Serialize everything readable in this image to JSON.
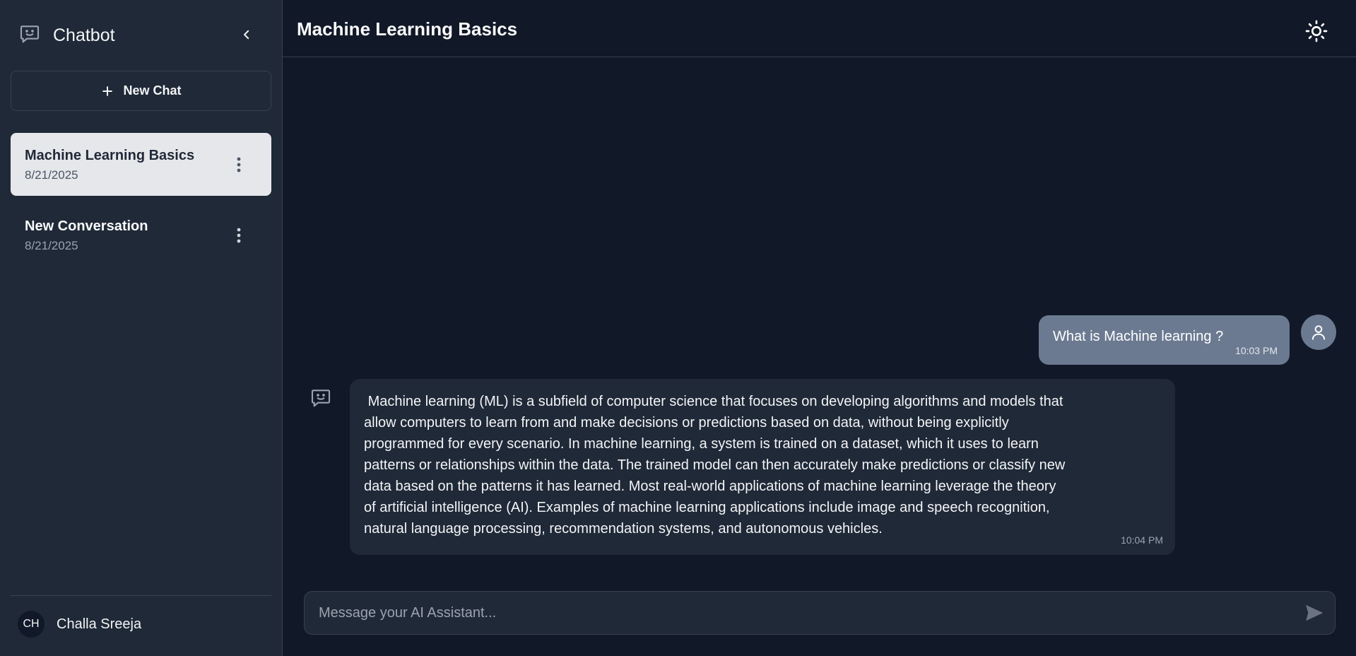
{
  "sidebar": {
    "brand_title": "Chatbot",
    "brand_icon": "chat-smile-icon",
    "collapse_icon": "chevron-left-icon",
    "new_chat_label": "New Chat",
    "conversations": [
      {
        "title": "Machine Learning Basics",
        "date": "8/21/2025",
        "active": true
      },
      {
        "title": "New Conversation",
        "date": "8/21/2025",
        "active": false
      }
    ],
    "user": {
      "initials": "CH",
      "name": "Challa Sreeja"
    }
  },
  "header": {
    "title": "Machine Learning Basics",
    "theme_icon": "sun-icon"
  },
  "messages": [
    {
      "role": "user",
      "text": "What is Machine learning ?",
      "time": "10:03 PM"
    },
    {
      "role": "assistant",
      "text": " Machine learning (ML) is a subfield of computer science that focuses on developing algorithms and models that\nallow computers to learn from and make decisions or predictions based on data, without being explicitly\nprogrammed for every scenario. In machine learning, a system is trained on a dataset, which it uses to learn\npatterns or relationships within the data. The trained model can then accurately make predictions or classify new\ndata based on the patterns it has learned. Most real-world applications of machine learning leverage the theory\nof artificial intelligence (AI). Examples of machine learning applications include image and speech recognition,\nnatural language processing, recommendation systems, and autonomous vehicles.",
      "time": "10:04 PM"
    }
  ],
  "composer": {
    "placeholder": "Message your AI Assistant...",
    "value": "",
    "send_icon": "send-icon"
  },
  "colors": {
    "sidebar_bg": "#1f2937",
    "main_bg": "#111827",
    "active_item_bg": "#e5e7eb",
    "user_bubble": "#6b7a91",
    "bot_bubble": "#1f2937"
  }
}
